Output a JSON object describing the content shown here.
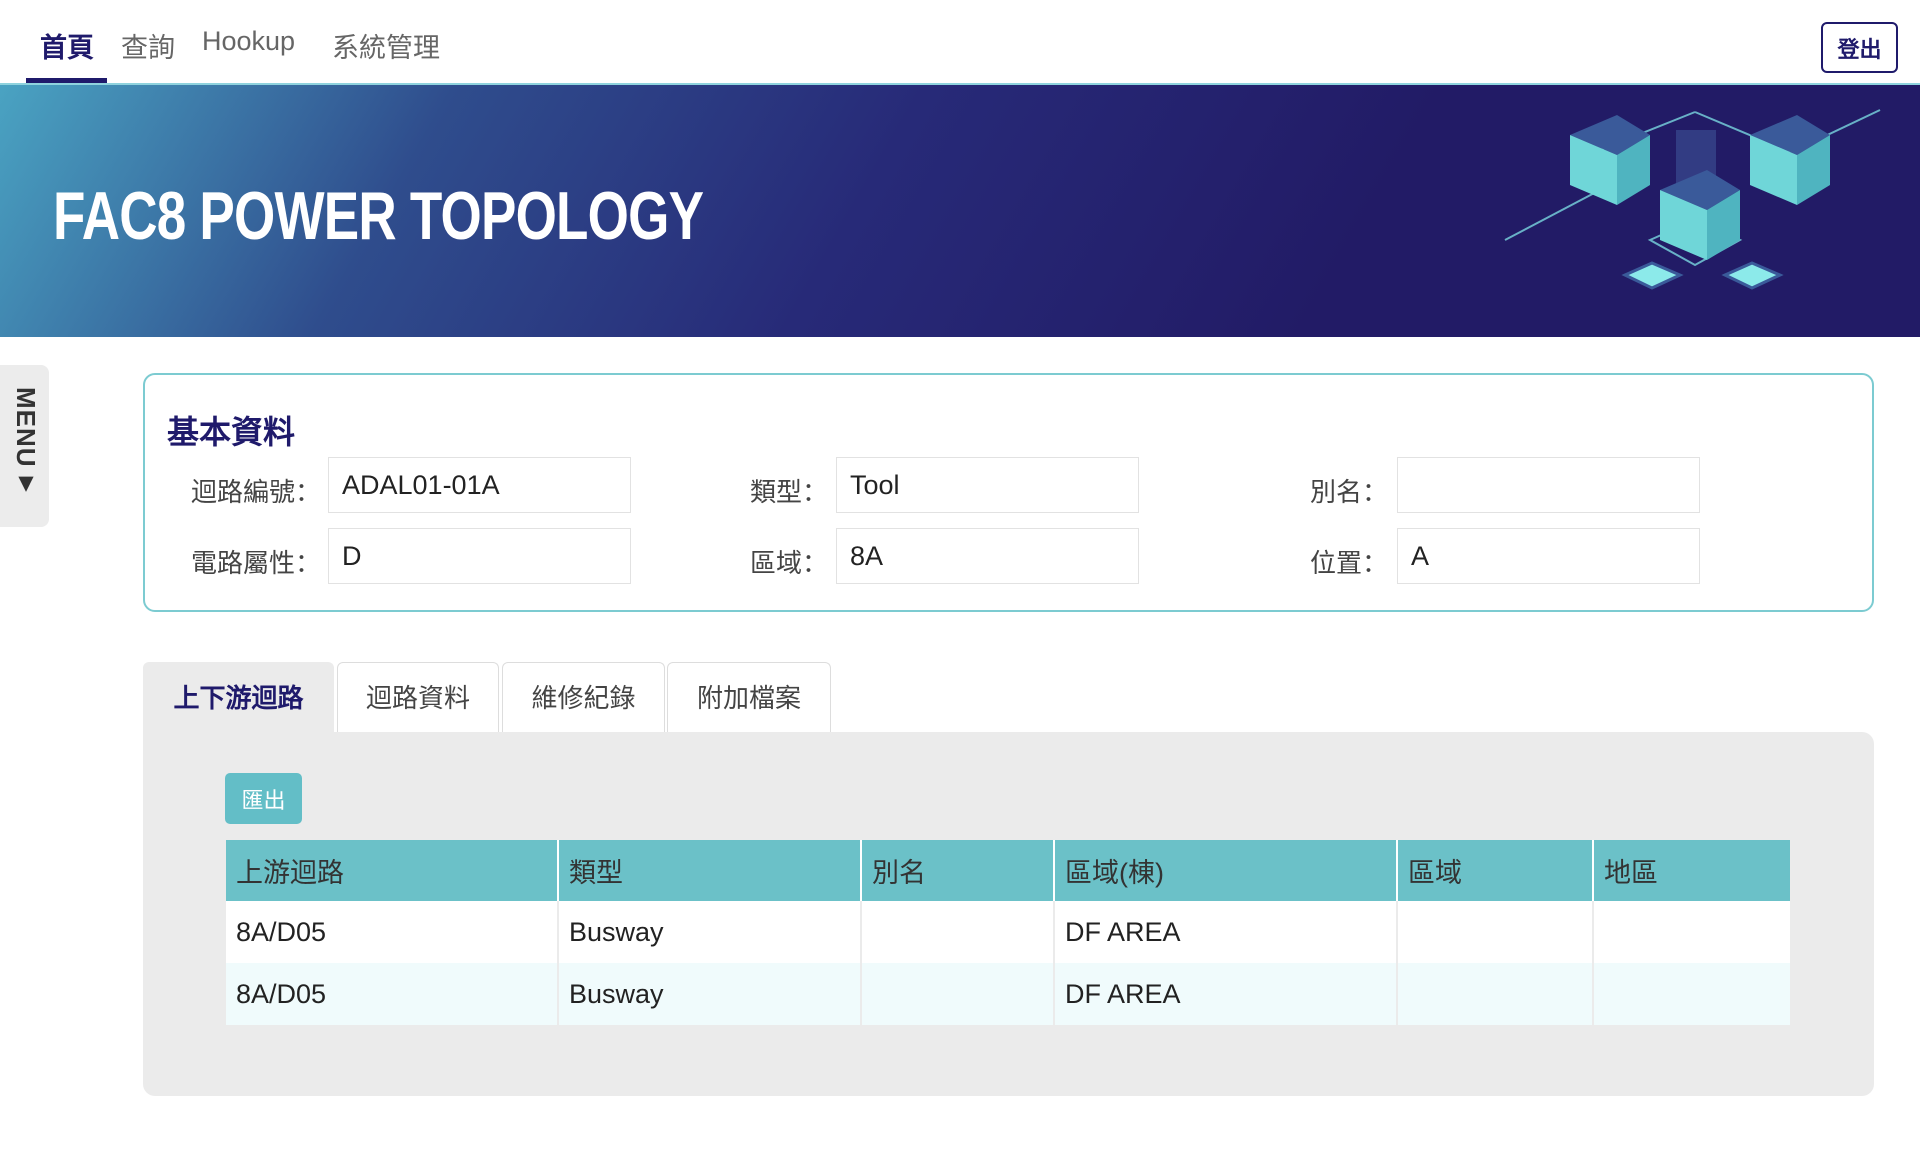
{
  "nav": {
    "items": [
      "首頁",
      "查詢",
      "Hookup",
      "系統管理"
    ],
    "active": "首頁",
    "logout": "登出"
  },
  "banner": {
    "title": "FAC8 POWER TOPOLOGY"
  },
  "menu": {
    "label": "MENU▼"
  },
  "basic_info": {
    "title": "基本資料",
    "fields": [
      {
        "label": "迴路編號：",
        "value": "ADAL01-01A"
      },
      {
        "label": "類型：",
        "value": "Tool"
      },
      {
        "label": "別名：",
        "value": ""
      },
      {
        "label": "電路屬性：",
        "value": "D"
      },
      {
        "label": "區域：",
        "value": "8A"
      },
      {
        "label": "位置：",
        "value": "A"
      }
    ]
  },
  "tabs": [
    "上下游迴路",
    "迴路資料",
    "維修紀錄",
    "附加檔案"
  ],
  "panel": {
    "export_label": "匯出",
    "columns": [
      "上游迴路",
      "類型",
      "別名",
      "區域(棟)",
      "區域",
      "地區"
    ],
    "rows": [
      [
        "8A/D05",
        "Busway",
        "",
        "DF AREA",
        "",
        ""
      ],
      [
        "8A/D05",
        "Busway",
        "",
        "DF AREA",
        "",
        ""
      ]
    ]
  },
  "colors": {
    "primary": "#1f1a6b",
    "accent": "#6bc1c8",
    "border": "#7ccbd1"
  }
}
